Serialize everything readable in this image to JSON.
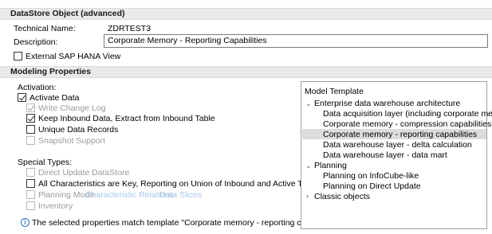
{
  "datastore_section": {
    "title": "DataStore Object (advanced)",
    "technical_name_label": "Technical Name:",
    "technical_name_value": "ZDRTEST3",
    "description_label": "Description:",
    "description_value": "Corporate Memory - Reporting Capabilities",
    "external_hana_view": {
      "label": "External SAP HANA View",
      "checked": false
    }
  },
  "modeling_section": {
    "title": "Modeling Properties",
    "activation_label": "Activation:",
    "options": {
      "activate_data": {
        "label": "Activate Data",
        "checked": true,
        "enabled": true
      },
      "write_change_log": {
        "label": "Write Change Log",
        "checked": true,
        "enabled": false
      },
      "keep_inbound": {
        "label": "Keep Inbound Data, Extract from Inbound Table",
        "checked": true,
        "enabled": true
      },
      "unique_records": {
        "label": "Unique Data Records",
        "checked": false,
        "enabled": true
      },
      "snapshot_support": {
        "label": "Snapshot Support",
        "checked": false,
        "enabled": false
      }
    },
    "special_types_label": "Special Types:",
    "special_types": {
      "direct_update": {
        "label": "Direct Update DataStore",
        "checked": false,
        "enabled": false
      },
      "all_characteristics_key": {
        "label": "All Characteristics are Key, Reporting on Union of Inbound and Active Table",
        "checked": false,
        "enabled": true
      },
      "planning_mode": {
        "label": "Planning Mode",
        "checked": false,
        "enabled": false,
        "link1": "Characteristic Relations",
        "link2": "Data Slices"
      },
      "inventory": {
        "label": "Inventory",
        "checked": false,
        "enabled": false
      }
    },
    "info_message": "The selected properties match template \"Corporate memory - reporting capabilities\"."
  },
  "model_template": {
    "title": "Model Template",
    "groups": [
      {
        "label": "Enterprise data warehouse architecture",
        "expanded": true,
        "items": [
          "Data acquisition layer (including corporate memory)",
          "Corporate memory - compression capabilities",
          "Corporate memory - reporting capabilities",
          "Data warehouse layer - delta calculation",
          "Data warehouse layer - data mart"
        ]
      },
      {
        "label": "Planning",
        "expanded": true,
        "items": [
          "Planning on InfoCube-like",
          "Planning on Direct Update"
        ]
      },
      {
        "label": "Classic objects",
        "expanded": false,
        "items": []
      }
    ],
    "selected_item": "Corporate memory - reporting capabilities"
  }
}
